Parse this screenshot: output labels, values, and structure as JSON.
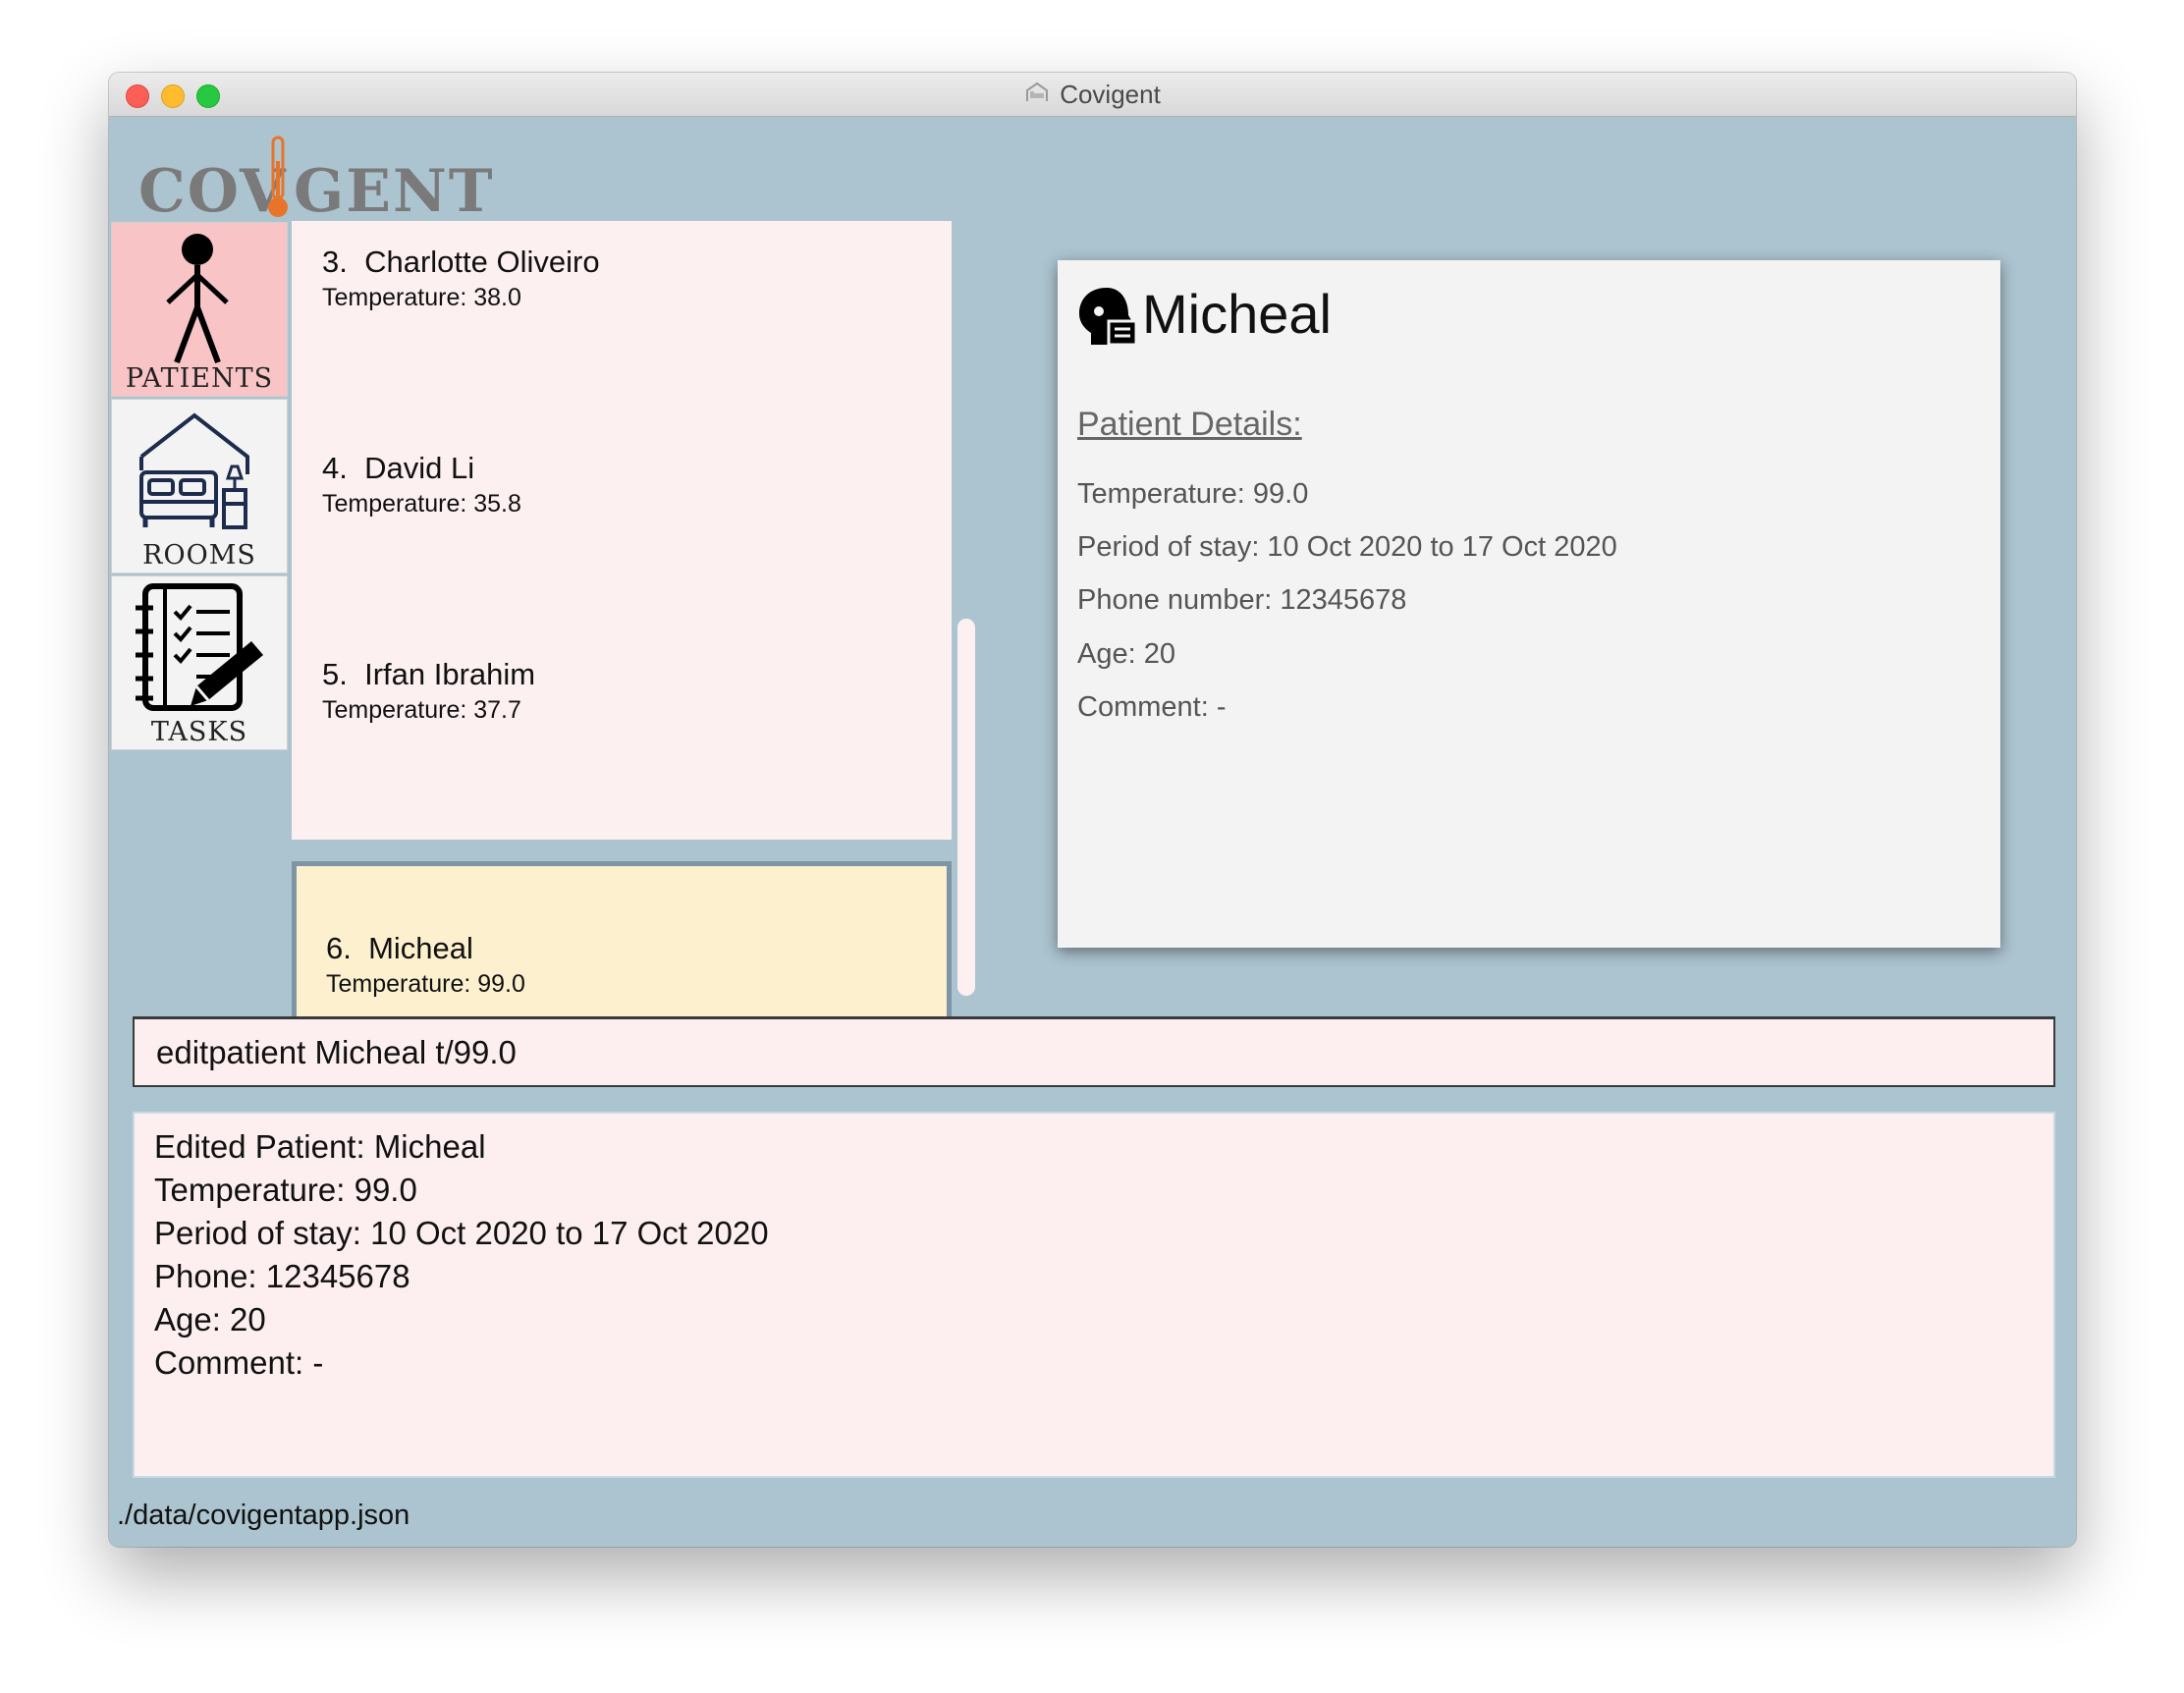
{
  "window": {
    "title": "Covigent",
    "logo_text_left": "COV",
    "logo_text_right": "GENT"
  },
  "nav": {
    "tabs": [
      {
        "label": "PATIENTS",
        "icon": "person-icon",
        "active": true
      },
      {
        "label": "ROOMS",
        "icon": "bed-icon",
        "active": false
      },
      {
        "label": "TASKS",
        "icon": "checklist-icon",
        "active": false
      }
    ]
  },
  "patients": [
    {
      "index": "3.",
      "name": "Charlotte Oliveiro",
      "temperature": "Temperature: 38.0"
    },
    {
      "index": "4.",
      "name": "David Li",
      "temperature": "Temperature: 35.8"
    },
    {
      "index": "5.",
      "name": "Irfan Ibrahim",
      "temperature": "Temperature: 37.7"
    },
    {
      "index": "6.",
      "name": "Micheal",
      "temperature": "Temperature: 99.0",
      "selected": true
    }
  ],
  "detail": {
    "name": "Micheal",
    "section_title": "Patient Details:",
    "lines": [
      "Temperature: 99.0",
      "Period of stay: 10 Oct 2020 to 17 Oct 2020",
      "Phone number: 12345678",
      "Age: 20",
      "Comment: -"
    ]
  },
  "command": {
    "value": "editpatient Micheal t/99.0"
  },
  "result": {
    "lines": [
      "Edited Patient: Micheal",
      "Temperature: 99.0",
      "Period of stay: 10 Oct 2020 to 17 Oct 2020",
      "Phone: 12345678",
      "Age: 20",
      "Comment: -"
    ]
  },
  "status": {
    "file_path": "./data/covigentapp.json"
  },
  "colors": {
    "window_bg": "#acc4d0",
    "card_bg": "#fdf0f1",
    "selected_card_bg": "#fdf0cf",
    "active_tab_bg": "#f9c4c6",
    "thermometer": "#e8742a"
  }
}
